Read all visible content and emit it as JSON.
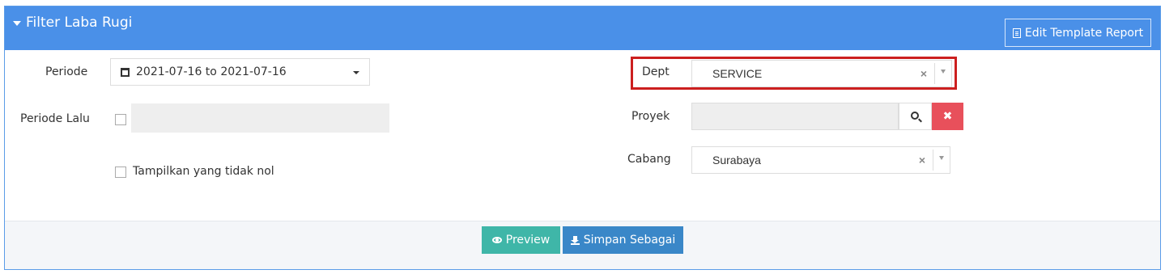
{
  "header": {
    "title": "Filter Laba Rugi",
    "edit_button": "Edit Template Report"
  },
  "left": {
    "periode_label": "Periode",
    "periode_value": "2021-07-16 to 2021-07-16",
    "periode_lalu_label": "Periode Lalu",
    "periode_lalu_value": "",
    "tampilkan_label": "Tampilkan yang tidak nol"
  },
  "right": {
    "dept_label": "Dept",
    "dept_value": "SERVICE",
    "proyek_label": "Proyek",
    "proyek_value": "",
    "cabang_label": "Cabang",
    "cabang_value": "Surabaya"
  },
  "footer": {
    "preview_label": "Preview",
    "save_label": "Simpan Sebagai"
  },
  "colors": {
    "header_bg": "#4a90e8",
    "preview_bg": "#3fb6a8",
    "save_bg": "#3a87c8",
    "clear_bg": "#e8505b",
    "highlight": "#cc1f1f"
  }
}
